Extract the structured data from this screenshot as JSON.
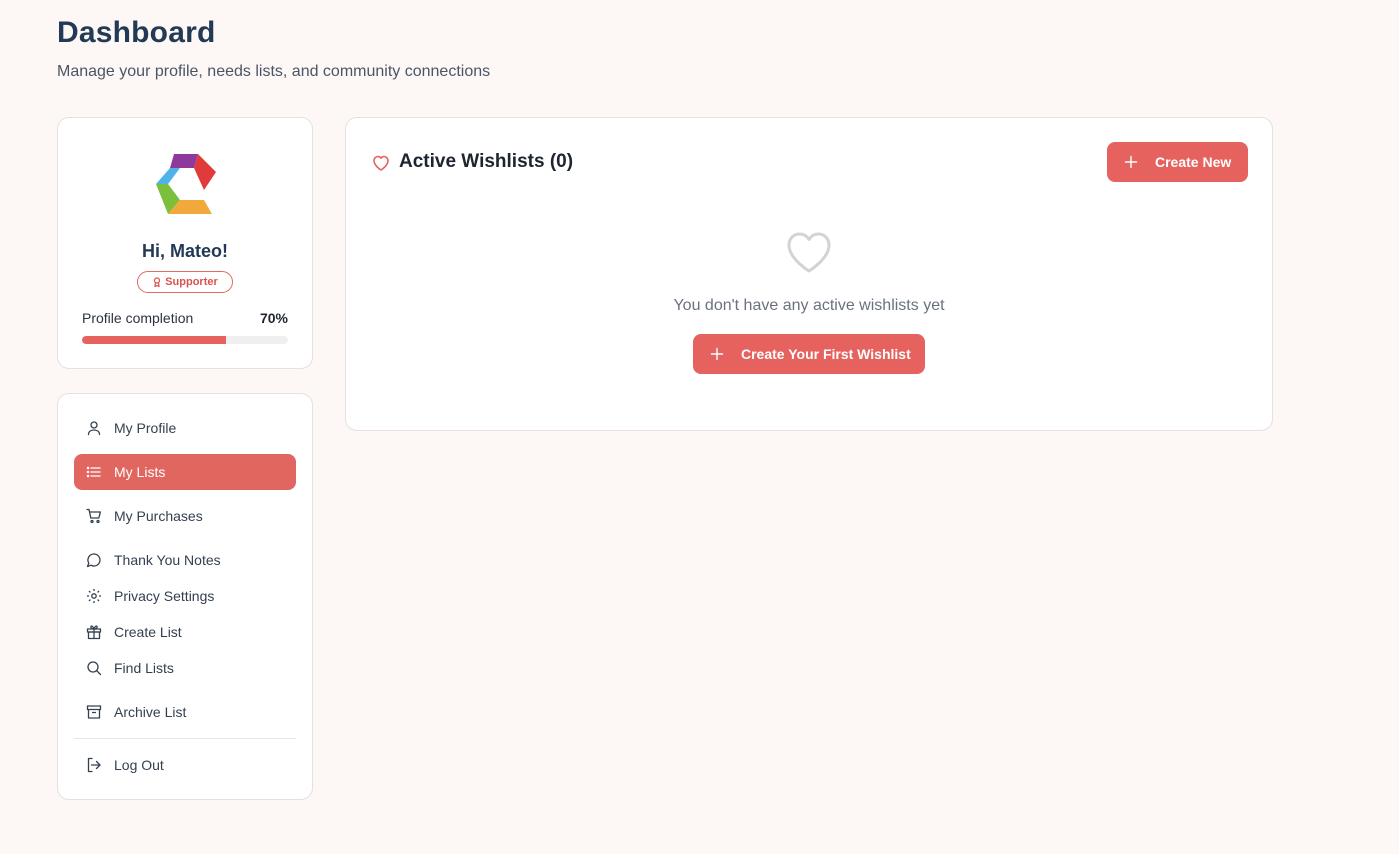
{
  "header": {
    "title": "Dashboard",
    "subtitle": "Manage your profile, needs lists, and community connections"
  },
  "profile": {
    "greeting": "Hi, Mateo!",
    "badge": "Supporter",
    "completion_label": "Profile completion",
    "completion_value": "70%",
    "completion_fraction": 0.7
  },
  "nav": {
    "items": [
      {
        "label": "My Profile",
        "icon": "user-icon"
      },
      {
        "label": "My Lists",
        "icon": "list-icon",
        "active": true
      },
      {
        "label": "My Purchases",
        "icon": "cart-icon"
      },
      {
        "label": "Thank You Notes",
        "icon": "message-icon"
      },
      {
        "label": "Privacy Settings",
        "icon": "gear-icon"
      },
      {
        "label": "Create List",
        "icon": "gift-icon"
      },
      {
        "label": "Find Lists",
        "icon": "search-icon"
      },
      {
        "label": "Archive List",
        "icon": "archive-icon"
      },
      {
        "label": "Log Out",
        "icon": "logout-icon"
      }
    ]
  },
  "wishlists": {
    "title": "Active Wishlists (0)",
    "create_new_label": "Create New",
    "empty_text": "You don't have any active wishlists yet",
    "create_first_label": "Create Your First Wishlist"
  },
  "colors": {
    "accent": "#e5625e",
    "background": "#fdf8f5",
    "heading": "#233a56"
  }
}
